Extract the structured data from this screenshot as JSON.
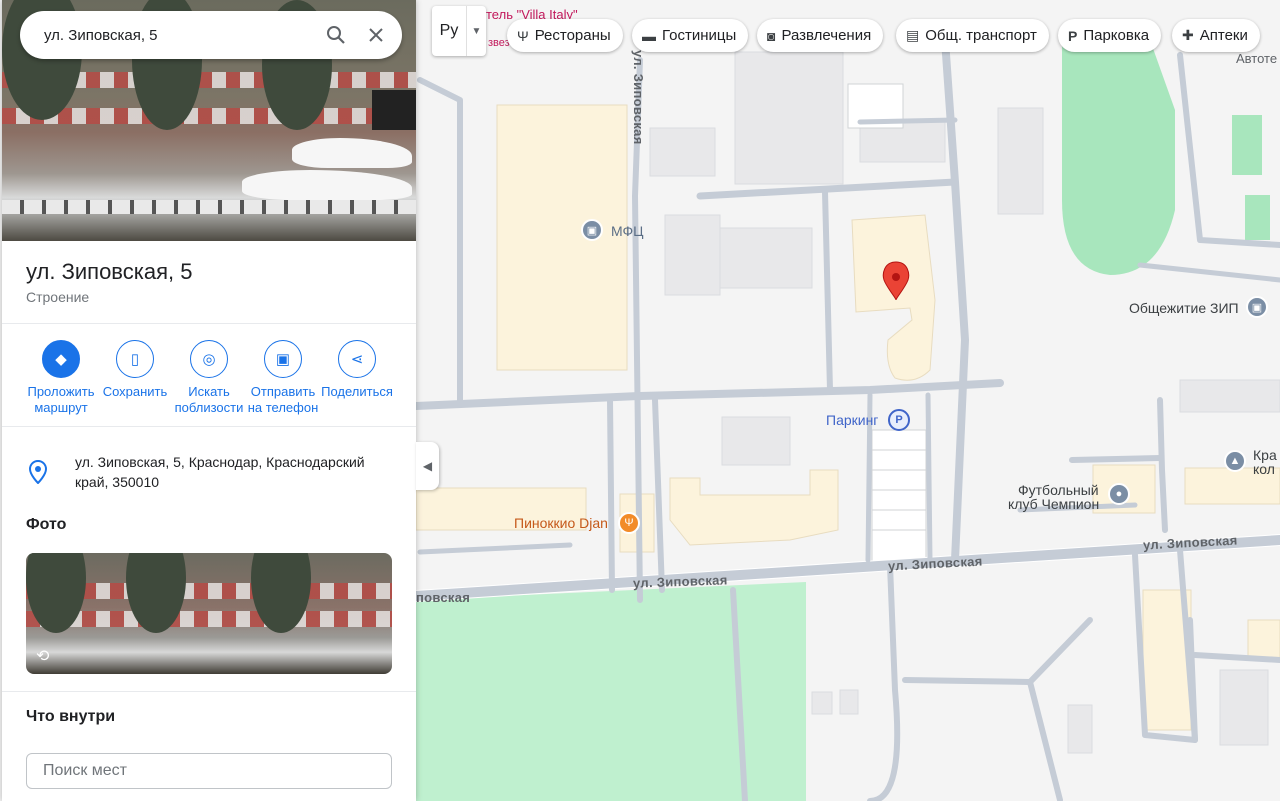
{
  "search": {
    "query": "ул. Зиповская, 5"
  },
  "place": {
    "title": "ул. Зиповская, 5",
    "type": "Строение",
    "address": "ул. Зиповская, 5, Краснодар, Краснодарский край, 350010"
  },
  "actions": [
    {
      "label": "Проложить маршрут",
      "icon": "directions-icon"
    },
    {
      "label": "Сохранить",
      "icon": "bookmark-icon"
    },
    {
      "label": "Искать поблизости",
      "icon": "nearby-icon"
    },
    {
      "label": "Отправить на телефон",
      "icon": "send-to-phone-icon"
    },
    {
      "label": "Поделиться",
      "icon": "share-icon"
    }
  ],
  "photos": {
    "title": "Фото"
  },
  "inside": {
    "title": "Что внутри",
    "placeholder": "Поиск мест"
  },
  "layer": {
    "lang": "Ру"
  },
  "chips": [
    {
      "label": "Рестораны",
      "icon": "restaurant-icon"
    },
    {
      "label": "Гостиницы",
      "icon": "hotel-icon"
    },
    {
      "label": "Развлечения",
      "icon": "camera-icon"
    },
    {
      "label": "Общ. транспорт",
      "icon": "transit-icon"
    },
    {
      "label": "Парковка",
      "icon": "parking-icon"
    },
    {
      "label": "Аптеки",
      "icon": "pharmacy-icon"
    }
  ],
  "map_labels": {
    "mfc": "МФЦ",
    "parking": "Паркинг",
    "parking_badge": "P",
    "dorm": "Общежитие ЗИП",
    "football_1": "Футбольный",
    "football_2": "клуб Чемпион",
    "pinocchio": "Пиноккио Djan",
    "kra_1": "Кра",
    "kra_2": "кол",
    "avto": "Автоте",
    "hotel": "тель \"Villa Italy\"",
    "hotel_sub": "звез",
    "street_main_1": "ул. Зиповская",
    "street_main_2": "ул. Зиповская",
    "street_main_3": "ул. Зиповская",
    "street_left": "повская",
    "street_vertical": "ул. Зиповская"
  },
  "colors": {
    "accent": "#1a73e8",
    "marker": "#ea4335",
    "park": "#bff0cf",
    "building": "#fcf3dc"
  }
}
